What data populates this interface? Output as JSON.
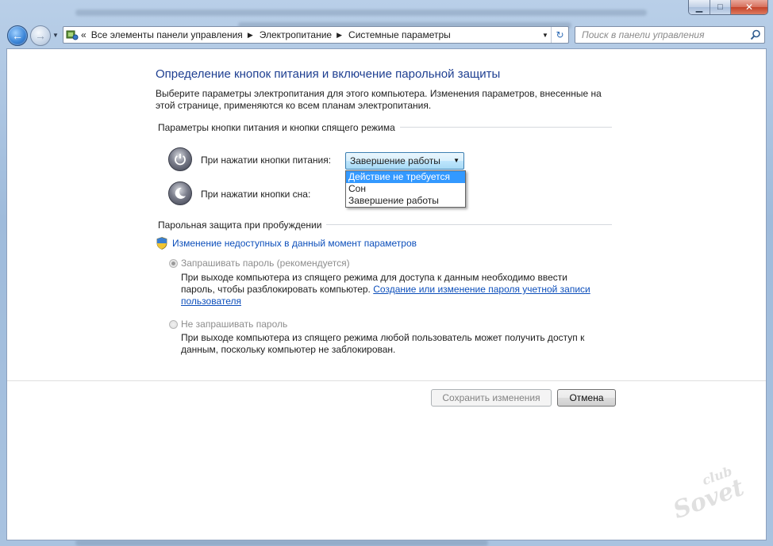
{
  "window": {
    "minimize_glyph": "▁",
    "maximize_glyph": "□",
    "close_glyph": "✕"
  },
  "nav": {
    "back_glyph": "←",
    "forward_glyph": "→",
    "breadcrumb": [
      "Все элементы панели управления",
      "Электропитание",
      "Системные параметры"
    ],
    "search_placeholder": "Поиск в панели управления"
  },
  "page": {
    "title": "Определение кнопок питания и включение парольной защиты",
    "description": "Выберите параметры электропитания для этого компьютера. Изменения параметров, внесенные на этой странице, применяются ко всем планам электропитания.",
    "buttons_section": {
      "title": "Параметры кнопки питания и кнопки спящего режима",
      "power_label": "При нажатии кнопки питания:",
      "sleep_label": "При нажатии кнопки сна:",
      "power_selected": "Завершение работы",
      "options": [
        "Действие не требуется",
        "Сон",
        "Завершение работы"
      ],
      "highlighted_option": "Действие не требуется"
    },
    "password_section": {
      "title": "Парольная защита при пробуждении",
      "change_link": "Изменение недоступных в данный момент параметров",
      "require_label": "Запрашивать пароль (рекомендуется)",
      "require_desc": "При выходе компьютера из спящего режима для доступа к данным необходимо ввести пароль, чтобы разблокировать компьютер.",
      "require_link": "Создание или изменение пароля учетной записи пользователя",
      "no_require_label": "Не запрашивать пароль",
      "no_require_desc": "При выходе компьютера из спящего режима любой пользователь может получить доступ к данным, поскольку компьютер не заблокирован.",
      "require_checked": true
    },
    "actions": {
      "save": "Сохранить изменения",
      "cancel": "Отмена"
    }
  },
  "watermark": {
    "line1": "club",
    "line2": "Sovet"
  },
  "colors": {
    "title_blue": "#1e3f91",
    "link_blue": "#0d4fbb",
    "selection_blue": "#3399ff"
  }
}
